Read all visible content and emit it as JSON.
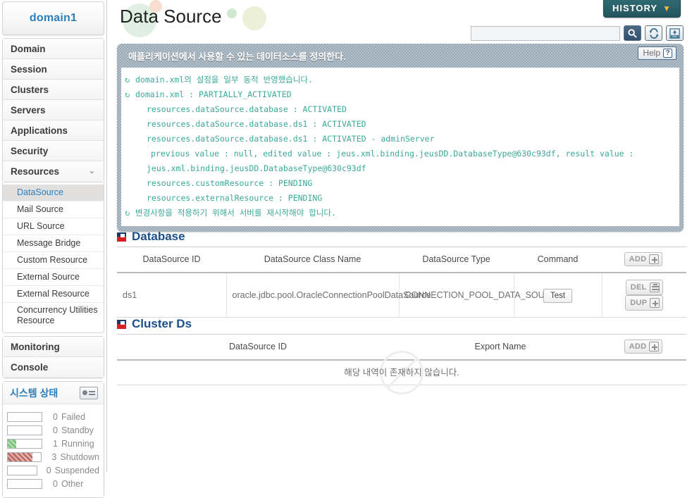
{
  "sidebar": {
    "domain_title": "domain1",
    "nav_items": [
      {
        "label": "Domain",
        "expandable": false
      },
      {
        "label": "Session",
        "expandable": false
      },
      {
        "label": "Clusters",
        "expandable": false
      },
      {
        "label": "Servers",
        "expandable": false
      },
      {
        "label": "Applications",
        "expandable": false
      },
      {
        "label": "Security",
        "expandable": false
      },
      {
        "label": "Resources",
        "expandable": true,
        "chevron": "⌄"
      }
    ],
    "submenu_items": [
      {
        "label": "DataSource",
        "active": true
      },
      {
        "label": "Mail Source",
        "active": false
      },
      {
        "label": "URL Source",
        "active": false
      },
      {
        "label": "Message Bridge",
        "active": false
      },
      {
        "label": "Custom Resource",
        "active": false
      },
      {
        "label": "External Source",
        "active": false
      },
      {
        "label": "External Resource",
        "active": false
      },
      {
        "label": "Concurrency Utilities Resource",
        "active": false
      }
    ],
    "lower_items": [
      {
        "label": "Monitoring"
      },
      {
        "label": "Console"
      }
    ],
    "system_status": {
      "title": "시스템 상태",
      "monitor_icon": "monitor-icon",
      "rows": [
        {
          "count": "0",
          "label": "Failed",
          "percent": 0,
          "color": "none"
        },
        {
          "count": "0",
          "label": "Standby",
          "percent": 0,
          "color": "none"
        },
        {
          "count": "1",
          "label": "Running",
          "percent": 25,
          "color": "#7cc47c"
        },
        {
          "count": "3",
          "label": "Shutdown",
          "percent": 75,
          "color": "#c06c66"
        },
        {
          "count": "0",
          "label": "Suspended",
          "percent": 0,
          "color": "none"
        },
        {
          "count": "0",
          "label": "Other",
          "percent": 0,
          "color": "none"
        }
      ]
    }
  },
  "header": {
    "page_title": "Data Source",
    "history_label": "HISTORY",
    "history_chevron": "▼",
    "search_value": "",
    "search_placeholder": "",
    "icons": [
      "search-icon",
      "refresh-icon",
      "xml-export-icon"
    ]
  },
  "message_panel": {
    "heading": "애플리케이션에서 사용할 수 있는 데이터소스를 정의한다.",
    "help_label": "Help",
    "help_icon": "?",
    "lines": [
      {
        "icon": true,
        "indent": 0,
        "text": "domain.xml의 설정을 일부 동적 반영했습니다."
      },
      {
        "icon": true,
        "indent": 0,
        "text": "domain.xml : PARTIALLY_ACTIVATED"
      },
      {
        "icon": false,
        "indent": 1,
        "text": "resources.dataSource.database : ACTIVATED"
      },
      {
        "icon": false,
        "indent": 1,
        "text": "resources.dataSource.database.ds1 : ACTIVATED"
      },
      {
        "icon": false,
        "indent": 1,
        "text": "resources.dataSource.database.ds1 : ACTIVATED - adminServer"
      },
      {
        "icon": false,
        "indent": 2,
        "text": "previous value : null, edited value : jeus.xml.binding.jeusDD.DatabaseType@630c93df, result value :"
      },
      {
        "icon": false,
        "indent": 1,
        "text": "jeus.xml.binding.jeusDD.DatabaseType@630c93df"
      },
      {
        "icon": false,
        "indent": 1,
        "text": "resources.customResource : PENDING"
      },
      {
        "icon": false,
        "indent": 1,
        "text": "resources.externalResource : PENDING"
      },
      {
        "icon": true,
        "indent": 0,
        "text": "변경사항을 적용하기 위해서 서버를 재시작해야 합니다."
      }
    ]
  },
  "database_section": {
    "title": "Database",
    "columns": [
      "DataSource ID",
      "DataSource Class Name",
      "DataSource Type",
      "Command",
      ""
    ],
    "add_label": "ADD",
    "rows": [
      {
        "datasource_id": "ds1",
        "class_name": "oracle.jdbc.pool.OracleConnectionPoolDataSource",
        "type": "CONNECTION_POOL_DATA_SOURCE",
        "command_label": "Test",
        "del_label": "DEL",
        "dup_label": "DUP"
      }
    ]
  },
  "cluster_section": {
    "title": "Cluster Ds",
    "columns": [
      "DataSource ID",
      "Export Name",
      ""
    ],
    "add_label": "ADD",
    "empty_text": "해당 내역이 존재하지 않습니다."
  }
}
